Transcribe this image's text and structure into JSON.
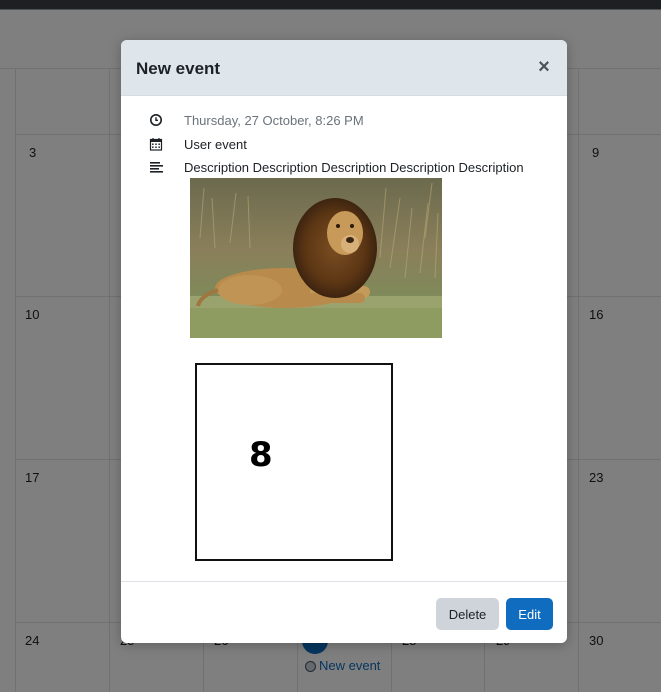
{
  "calendar": {
    "day_numbers": [
      "3",
      "9",
      "10",
      "16",
      "17",
      "23",
      "24",
      "30"
    ],
    "partial_day_numbers": [
      "25",
      "26",
      "28",
      "29"
    ],
    "event_label": "New event",
    "event_icon": "circle-dot-icon"
  },
  "modal": {
    "title": "New event",
    "close_label": "×",
    "datetime": "Thursday, 27 October, 8:26 PM",
    "event_type": "User event",
    "description": "Description Description Description Description Description",
    "icons": [
      "clock-icon",
      "calendar-icon",
      "description-lines-icon",
      "close-icon"
    ],
    "figure_number": "8",
    "delete_label": "Delete",
    "edit_label": "Edit"
  },
  "colors": {
    "header_bg": "#dee6ec",
    "primary": "#0f6cbf",
    "secondary_button": "#ced4da",
    "backdrop": "rgba(0,0,0,0.5)"
  }
}
